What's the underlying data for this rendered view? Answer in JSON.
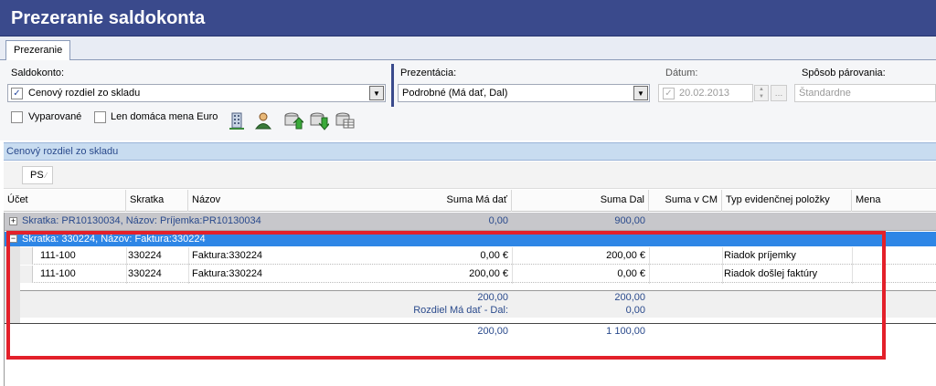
{
  "window": {
    "title": "Prezeranie saldokonta"
  },
  "tabs": [
    {
      "label": "Prezeranie"
    }
  ],
  "filters": {
    "saldokonto_label": "Saldokonto:",
    "saldokonto_value": "Cenový rozdiel zo skladu",
    "vyparovane_label": "Vyparované",
    "len_domaca_label": "Len domáca mena Euro",
    "prezentacia_label": "Prezentácia:",
    "prezentacia_value": "Podrobné (Má dať, Dal)",
    "datum_label": "Dátum:",
    "datum_value": "20.02.2013",
    "sposob_label": "Spôsob párovania:",
    "sposob_placeholder": "Štandardne"
  },
  "toolbar_icons": [
    "building-icon",
    "user-icon",
    "db-export-up-icon",
    "db-export-down-icon",
    "db-grid-icon"
  ],
  "section": {
    "title": "Cenový rozdiel zo skladu"
  },
  "grouping": {
    "chip": "PS"
  },
  "columns": {
    "ucet": "Účet",
    "skratka": "Skratka",
    "nazov": "Názov",
    "suma_ma_dat": "Suma Má dať",
    "suma_dal": "Suma Dal",
    "suma_v_cm": "Suma v CM",
    "typ": "Typ evidenčnej položky",
    "mena": "Mena"
  },
  "group1": {
    "caption": "Skratka: PR10130034, Názov: Príjemka:PR10130034",
    "ma_dat": "0,00",
    "dal": "900,00"
  },
  "group2": {
    "caption": "Skratka: 330224, Názov: Faktura:330224",
    "rows": [
      {
        "ucet": "111-100",
        "skratka": "330224",
        "nazov": "Faktura:330224",
        "ma_dat": "0,00 €",
        "dal": "200,00 €",
        "typ": "Riadok príjemky"
      },
      {
        "ucet": "111-100",
        "skratka": "330224",
        "nazov": "Faktura:330224",
        "ma_dat": "200,00 €",
        "dal": "0,00 €",
        "typ": "Riadok došlej faktúry"
      }
    ],
    "total_ma_dat": "200,00",
    "total_dal": "200,00",
    "rozdiel_label": "Rozdiel Má dať - Dal:",
    "rozdiel_value": "0,00"
  },
  "grand_total": {
    "ma_dat": "200,00",
    "dal": "1 100,00"
  }
}
